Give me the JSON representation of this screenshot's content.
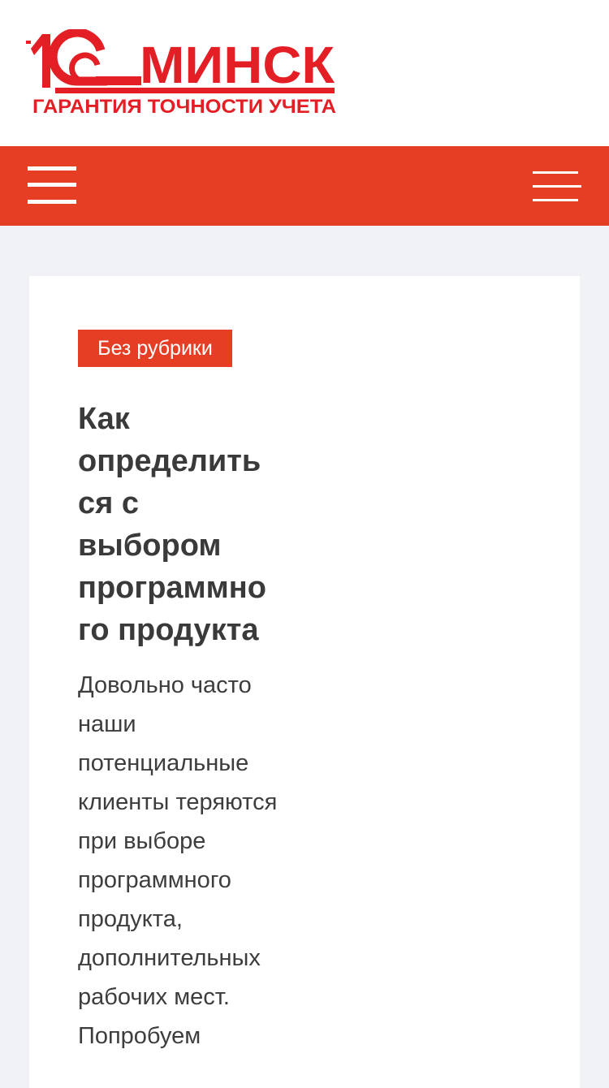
{
  "header": {
    "logo": {
      "icon": "1c-logo",
      "brand_text": "МИНСК",
      "tagline": "ГАРАНТИЯ ТОЧНОСТИ УЧЕТА",
      "color": "#e31e24"
    }
  },
  "nav": {
    "background": "#e63e24",
    "menu_icon": "hamburger-menu-icon",
    "search_icon": "search-menu-icon"
  },
  "post": {
    "category": "Без рубрики",
    "title": "Как определиться с выбором программного продукта",
    "excerpt": "Довольно часто наши потенциальные клиенты теряются при выборе программного продукта, дополнительных рабочих мест. Попробуем"
  }
}
